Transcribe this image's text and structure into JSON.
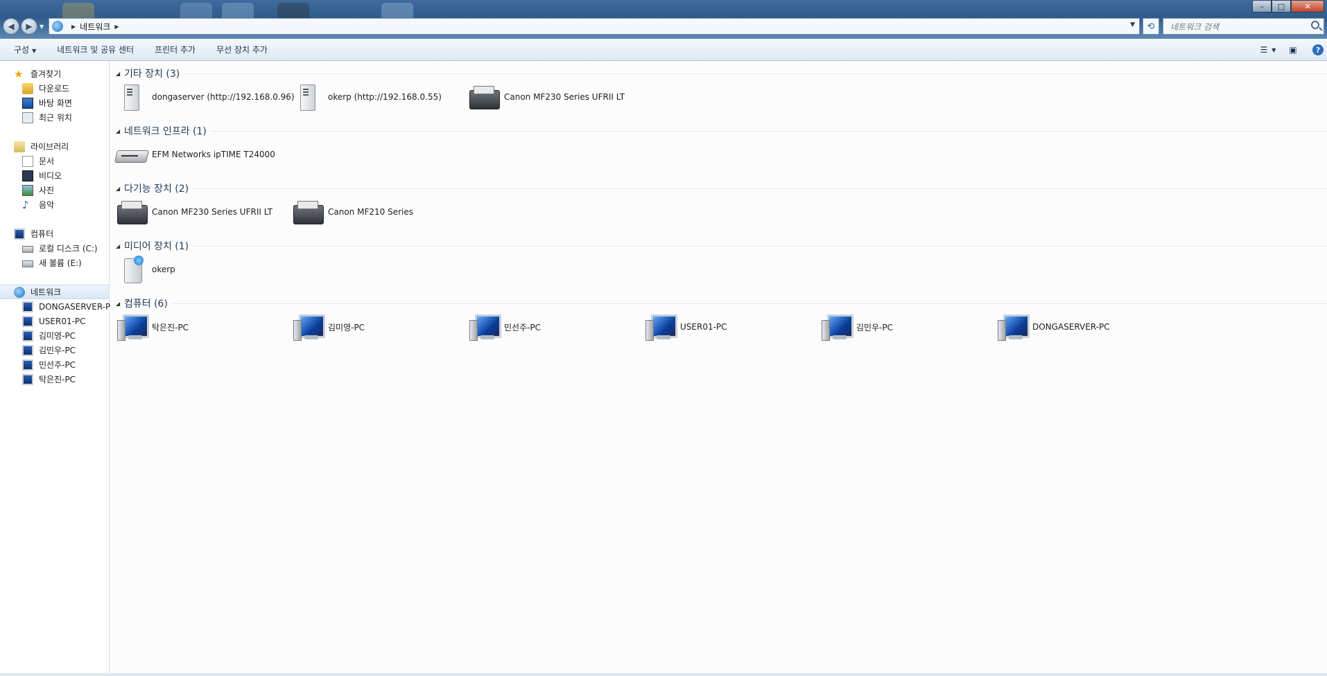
{
  "window": {
    "title_controls": {
      "minimize": "–",
      "maximize": "□",
      "close": "✕"
    }
  },
  "address": {
    "crumbs": [
      "네트워크"
    ],
    "search_placeholder": "네트워크 검색"
  },
  "toolbar": {
    "organize": "구성",
    "network_center": "네트워크 및 공유 센터",
    "add_printer": "프린터 추가",
    "add_wireless": "무선 장치 추가",
    "help": "?"
  },
  "sidebar": {
    "favorites": {
      "label": "즐겨찾기",
      "items": [
        "다운로드",
        "바탕 화면",
        "최근 위치"
      ]
    },
    "libraries": {
      "label": "라이브러리",
      "items": [
        "문서",
        "비디오",
        "사진",
        "음악"
      ]
    },
    "computer": {
      "label": "컴퓨터",
      "items": [
        "로컬 디스크 (C:)",
        "새 볼륨 (E:)"
      ]
    },
    "network": {
      "label": "네트워크",
      "items": [
        "DONGASERVER-PC",
        "USER01-PC",
        "김미영-PC",
        "김민우-PC",
        "민선주-PC",
        "탁은진-PC"
      ]
    }
  },
  "groups": [
    {
      "title": "기타 장치 (3)",
      "items": [
        {
          "label": "dongaserver (http://192.168.0.96)",
          "icon": "server-icon"
        },
        {
          "label": "okerp (http://192.168.0.55)",
          "icon": "server-icon"
        },
        {
          "label": "Canon MF230 Series UFRII LT",
          "icon": "printer-icon"
        }
      ]
    },
    {
      "title": "네트워크 인프라 (1)",
      "items": [
        {
          "label": "EFM Networks ipTIME T24000",
          "icon": "router-icon"
        }
      ]
    },
    {
      "title": "다기능 장치 (2)",
      "items": [
        {
          "label": "Canon MF230 Series UFRII LT",
          "icon": "printer-icon"
        },
        {
          "label": "Canon MF210 Series",
          "icon": "printer-icon"
        }
      ]
    },
    {
      "title": "미디어 장치 (1)",
      "items": [
        {
          "label": "okerp",
          "icon": "media-server-icon"
        }
      ]
    },
    {
      "title": "컴퓨터 (6)",
      "items": [
        {
          "label": "탁은진-PC",
          "icon": "computer-icon"
        },
        {
          "label": "김미영-PC",
          "icon": "computer-icon"
        },
        {
          "label": "민선주-PC",
          "icon": "computer-icon"
        },
        {
          "label": "USER01-PC",
          "icon": "computer-icon"
        },
        {
          "label": "김민우-PC",
          "icon": "computer-icon"
        },
        {
          "label": "DONGASERVER-PC",
          "icon": "computer-icon"
        }
      ]
    }
  ]
}
